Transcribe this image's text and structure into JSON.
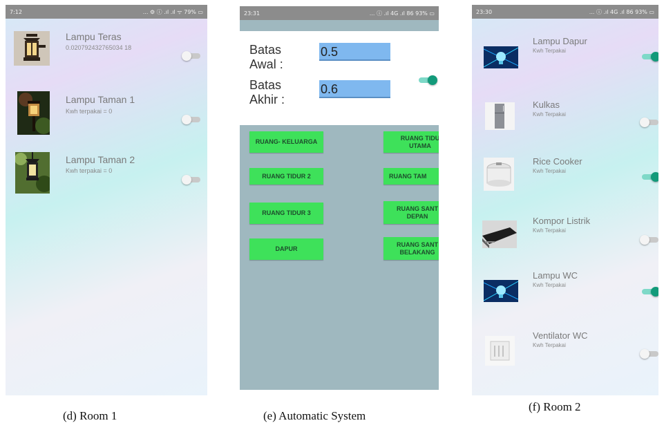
{
  "room1": {
    "status_time": "7:12",
    "status_right": "... ⚙ ⓘ .ıl .ıl ᯤ 79% ▭",
    "items": [
      {
        "title": "Lampu Teras",
        "subtitle": "0.020792432765034 18",
        "switch_on": false,
        "icon": "porch-lamp-photo"
      },
      {
        "title": "Lampu Taman 1",
        "subtitle": "Kwh terpakai = 0",
        "switch_on": false,
        "icon": "garden-lamp-photo"
      },
      {
        "title": "Lampu Taman 2",
        "subtitle": "Kwh terpakai = 0",
        "switch_on": false,
        "icon": "garden-lantern-photo"
      }
    ],
    "caption": "(d) Room 1"
  },
  "automatic": {
    "status_time": "23:31",
    "status_right": "... ⓘ .ıl 4G .ıl 86 93% ▭",
    "batas_awal_label": "Batas Awal :",
    "batas_awal_value": "0.5",
    "batas_akhir_label": "Batas Akhir :",
    "batas_akhir_value": "0.6",
    "switch_on": true,
    "buttons": [
      "RUANG- KELUARGA",
      "RUANG TIDU UTAMA",
      "RUANG TIDUR 2",
      "RUANG TAM",
      "RUANG TIDUR 3",
      "RUANG SANT DEPAN",
      "DAPUR",
      "RUANG SANT BELAKANG"
    ],
    "caption": "(e) Automatic System"
  },
  "room2": {
    "status_time": "23:30",
    "status_right": "... ⓘ .ıl 4G .ıl 86 93% ▭",
    "items": [
      {
        "title": "Lampu Dapur",
        "subtitle": "Kwh Terpakai",
        "switch_on": true,
        "icon": "bulb-photo"
      },
      {
        "title": "Kulkas",
        "subtitle": "Kwh Terpakai",
        "switch_on": false,
        "icon": "fridge-photo"
      },
      {
        "title": "Rice Cooker",
        "subtitle": "Kwh Terpakai",
        "switch_on": true,
        "icon": "rice-cooker-photo"
      },
      {
        "title": "Kompor Listrik",
        "subtitle": "Kwh Terpakai",
        "switch_on": false,
        "icon": "electric-stove-photo"
      },
      {
        "title": "Lampu WC",
        "subtitle": "Kwh Terpakai",
        "switch_on": true,
        "icon": "bulb-photo"
      },
      {
        "title": "Ventilator WC",
        "subtitle": "Kwh Terpakai",
        "switch_on": false,
        "icon": "ventilator-photo"
      }
    ],
    "caption": "(f) Room 2"
  },
  "colors": {
    "switch_on": "#129a7a",
    "switch_off": "#f4f4f4",
    "button_green": "#3ee15a",
    "input_blue": "#7fb8ef"
  }
}
